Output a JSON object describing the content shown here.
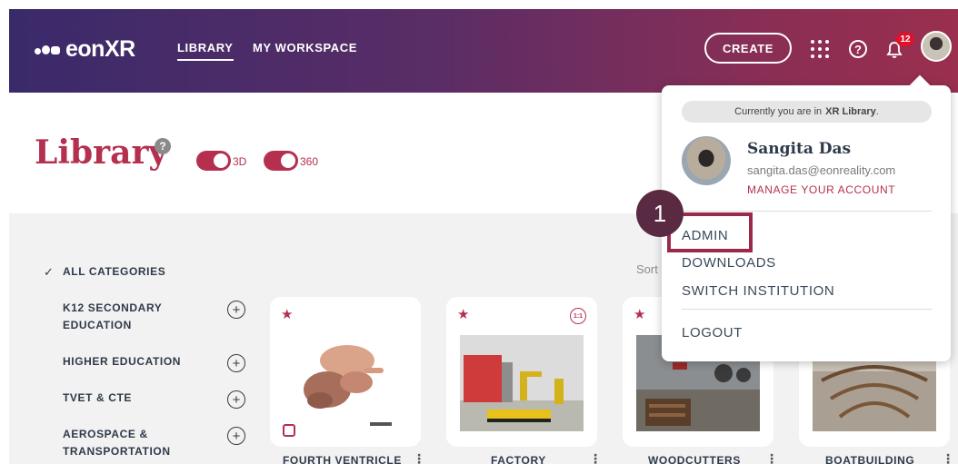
{
  "header": {
    "logo_text": "eonXR",
    "nav": {
      "library": "LIBRARY",
      "workspace": "MY WORKSPACE"
    },
    "create_label": "CREATE",
    "help_glyph": "?",
    "notification_count": "12"
  },
  "library": {
    "title": "Library",
    "help_glyph": "?",
    "toggles": [
      {
        "label": "3D",
        "on": true
      },
      {
        "label": "360",
        "on": true
      }
    ],
    "sort_label": "Sort"
  },
  "sidebar": {
    "all_categories": "ALL CATEGORIES",
    "categories": [
      {
        "line1": "K12 SECONDARY",
        "line2": "EDUCATION"
      },
      {
        "line1": "HIGHER EDUCATION",
        "line2": ""
      },
      {
        "line1": "TVET & CTE",
        "line2": ""
      },
      {
        "line1": "AEROSPACE &",
        "line2": "TRANSPORTATION"
      }
    ]
  },
  "cards": [
    {
      "title": "FOURTH VENTRICLE",
      "badge": ""
    },
    {
      "title": "FACTORY",
      "badge": "1:1"
    },
    {
      "title": "WOODCUTTERS",
      "badge": ""
    },
    {
      "title": "BOATBUILDING",
      "badge": ""
    }
  ],
  "dropdown": {
    "location_prefix": "Currently you are in",
    "location_name": "XR Library",
    "location_suffix": ".",
    "user_name": "Sangita Das",
    "user_email": "sangita.das@eonreality.com",
    "manage_account": "MANAGE YOUR ACCOUNT",
    "items": {
      "admin": "ADMIN",
      "downloads": "DOWNLOADS",
      "switch": "SWITCH INSTITUTION",
      "logout": "LOGOUT"
    }
  },
  "annotation": {
    "step": "1"
  },
  "colors": {
    "accent": "#b5304f",
    "header_start": "#3a2a6a",
    "header_end": "#9a2f4e",
    "highlight": "#9b2a4a"
  }
}
